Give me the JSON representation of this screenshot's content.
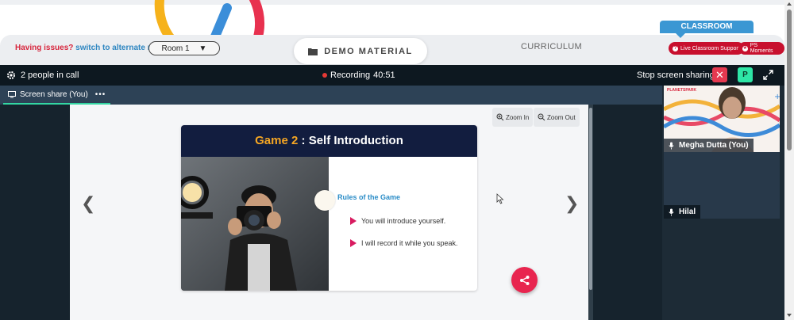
{
  "colors": {
    "accent_red": "#d7263d",
    "link_blue": "#2e86c1",
    "classroom_blue": "#3b97d3",
    "meet_bg": "#1d2b36",
    "meet_top": "#0d1820",
    "rec_red": "#e53935",
    "avatar_green": "#2ee6a6",
    "slide_navy": "#121d3f",
    "slide_gold": "#f5a623",
    "share_pink": "#e8254f"
  },
  "header": {
    "issue_text": "Having issues?",
    "switch_link": "switch to alternate room",
    "room_select": "Room 1",
    "demo_material": "DEMO MATERIAL",
    "curriculum": "CURRICULUM",
    "classroom_tab": "CLASSROOM",
    "live_support": "Live Classroom Support",
    "ps_moments": "PS Moments"
  },
  "meeting": {
    "people": "2 people in call",
    "recording_label": "Recording",
    "recording_time": "40:51",
    "stop_share": "Stop screen sharing",
    "stop_icon": "✕",
    "avatar_letter": "P",
    "tab_label": "Screen share (You)",
    "tab_more": "•••"
  },
  "share": {
    "zoom_in": "Zoom In",
    "zoom_out": "Zoom Out",
    "slide_title_pre": "Game",
    "slide_title_num": "2",
    "slide_title_post": ": Self Introduction",
    "rules_heading": "Rules of the Game",
    "rules": [
      "You will introduce yourself.",
      "I will record it while you speak."
    ],
    "nav_prev": "❮",
    "nav_next": "❯"
  },
  "participants": [
    {
      "name": "Megha Dutta (You)",
      "brand": "PLANETSPARK"
    },
    {
      "name": "Hilal"
    }
  ]
}
